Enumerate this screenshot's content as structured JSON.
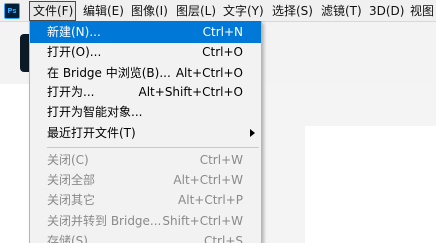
{
  "app": {
    "logo_text": "Ps"
  },
  "menubar": {
    "items": [
      {
        "label": "文件(F)"
      },
      {
        "label": "编辑(E)"
      },
      {
        "label": "图像(I)"
      },
      {
        "label": "图层(L)"
      },
      {
        "label": "文字(Y)"
      },
      {
        "label": "选择(S)"
      },
      {
        "label": "滤镜(T)"
      },
      {
        "label": "3D(D)"
      },
      {
        "label": "视图"
      }
    ]
  },
  "file_menu": {
    "items": [
      {
        "label": "新建(N)...",
        "shortcut": "Ctrl+N"
      },
      {
        "label": "打开(O)...",
        "shortcut": "Ctrl+O"
      },
      {
        "label": "在 Bridge 中浏览(B)...",
        "shortcut": "Alt+Ctrl+O"
      },
      {
        "label": "打开为...",
        "shortcut": "Alt+Shift+Ctrl+O"
      },
      {
        "label": "打开为智能对象...",
        "shortcut": ""
      },
      {
        "label": "最近打开文件(T)",
        "shortcut": ""
      },
      {
        "label": "关闭(C)",
        "shortcut": "Ctrl+W"
      },
      {
        "label": "关闭全部",
        "shortcut": "Alt+Ctrl+W"
      },
      {
        "label": "关闭其它",
        "shortcut": "Alt+Ctrl+P"
      },
      {
        "label": "关闭并转到 Bridge...",
        "shortcut": "Shift+Ctrl+W"
      },
      {
        "label": "存储(S)",
        "shortcut": "Ctrl+S"
      }
    ]
  },
  "colors": {
    "highlight": "#0078d7",
    "menu_bg": "#f2f2f2",
    "disabled_text": "#8a8a8a"
  }
}
